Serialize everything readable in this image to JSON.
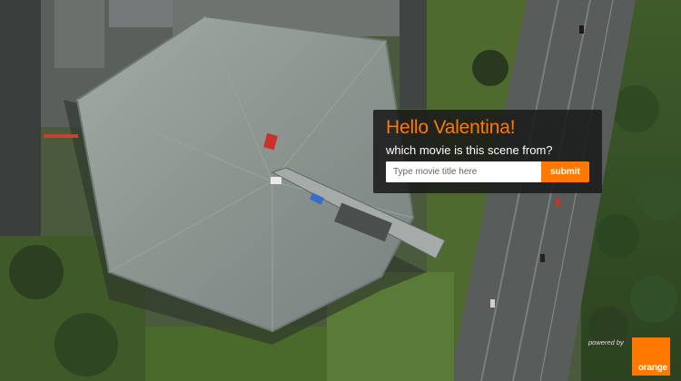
{
  "quiz": {
    "greeting": "Hello Valentina!",
    "question": "which movie is this scene from?",
    "input_placeholder": "Type movie title here",
    "input_value": "",
    "submit_label": "submit"
  },
  "branding": {
    "powered_by": "powered by",
    "logo_text": "orange"
  },
  "colors": {
    "accent": "#ff7900",
    "panel_bg": "#181818",
    "greeting_text": "#ff7900",
    "question_text": "#ffffff",
    "roof": "#8f9791",
    "grass": "#4e6a2e",
    "road": "#555a58"
  }
}
